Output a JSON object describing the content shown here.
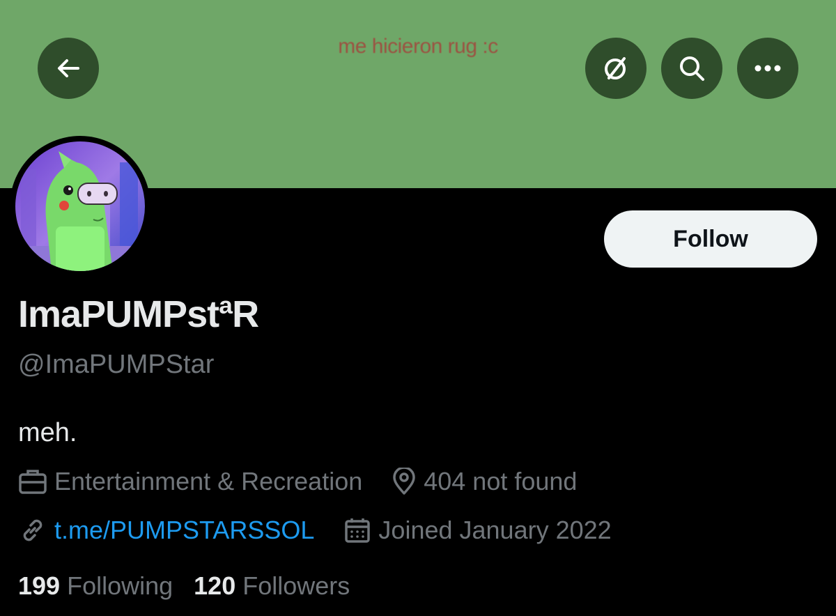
{
  "header": {
    "banner_text": "me hicieron rug :c",
    "banner_color": "#6fa768",
    "icons": {
      "back": "arrow-left-icon",
      "grok": "grok-slash-icon",
      "search": "search-icon",
      "more": "more-horizontal-icon"
    }
  },
  "profile": {
    "display_name": "ImaPUMPstªR",
    "handle": "@ImaPUMPStar",
    "bio": "meh.",
    "follow_label": "Follow",
    "category": "Entertainment & Recreation",
    "location": "404 not found",
    "link": "t.me/PUMPSTARSSOL",
    "joined": "Joined January 2022"
  },
  "stats": {
    "following_count": "199",
    "following_label": "Following",
    "followers_count": "120",
    "followers_label": "Followers"
  },
  "colors": {
    "link": "#1d9bf0",
    "muted": "#71767b",
    "button_bg": "#2f4d2b"
  }
}
